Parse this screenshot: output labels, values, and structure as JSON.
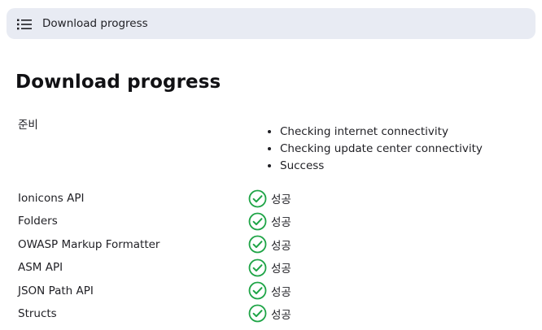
{
  "breadcrumb": {
    "icon": "list-icon",
    "label": "Download progress"
  },
  "page": {
    "title": "Download progress"
  },
  "preparation": {
    "label": "준비",
    "steps": [
      "Checking internet connectivity",
      "Checking update center connectivity",
      "Success"
    ]
  },
  "plugins": [
    {
      "name": "Ionicons API",
      "status": "성공"
    },
    {
      "name": "Folders",
      "status": "성공"
    },
    {
      "name": "OWASP Markup Formatter",
      "status": "성공"
    },
    {
      "name": "ASM API",
      "status": "성공"
    },
    {
      "name": "JSON Path API",
      "status": "성공"
    },
    {
      "name": "Structs",
      "status": "성공"
    }
  ],
  "colors": {
    "breadcrumb_bg": "#e8ebf3",
    "success": "#1ea446"
  },
  "icons": {
    "status": "check-circle-icon"
  }
}
